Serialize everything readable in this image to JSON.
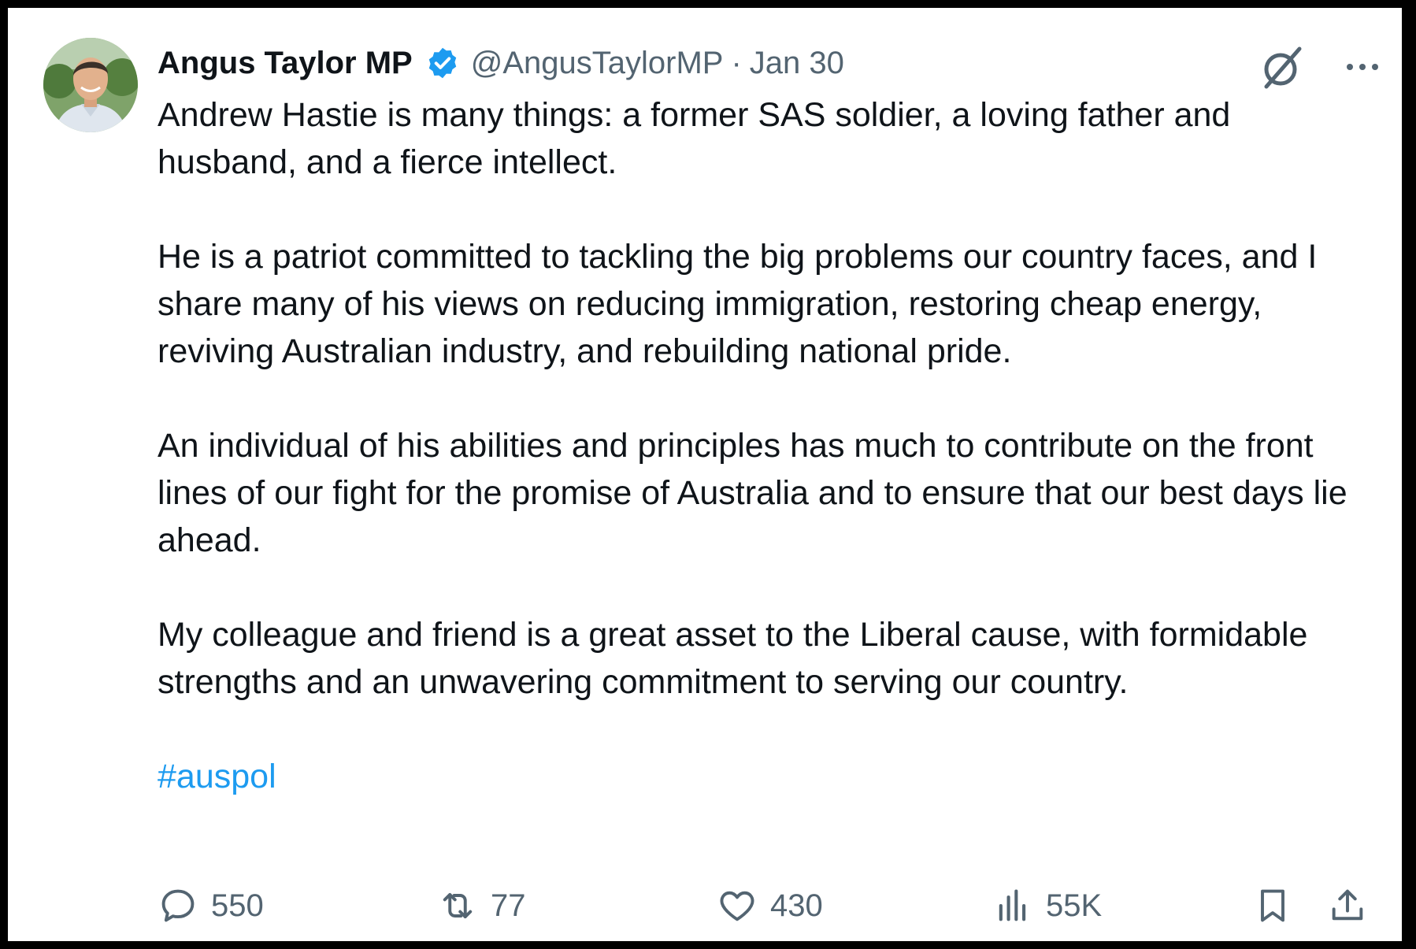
{
  "tweet": {
    "author_name": "Angus Taylor MP",
    "handle": "@AngusTaylorMP",
    "separator": "·",
    "date": "Jan 30",
    "paragraphs": [
      "Andrew Hastie is many things: a former SAS soldier, a loving father and husband, and a fierce intellect.",
      "He is a patriot committed to tackling the big problems our country faces, and I share many of his views on reducing immigration, restoring cheap energy, reviving Australian industry, and rebuilding national pride.",
      "An individual of his abilities and principles has much to contribute on the front lines of our fight for the promise of Australia and to ensure that our best days lie ahead.",
      "My colleague and friend is a great asset to the Liberal cause, with formidable strengths and an unwavering commitment to serving our country."
    ],
    "hashtag": "#auspol"
  },
  "actions": {
    "replies": "550",
    "reposts": "77",
    "likes": "430",
    "views": "55K"
  },
  "icons": {
    "verified": "verified-badge-icon",
    "grok": "grok-icon",
    "more": "more-icon",
    "reply": "reply-icon",
    "repost": "repost-icon",
    "like": "heart-icon",
    "views": "views-icon",
    "bookmark": "bookmark-icon",
    "share": "share-icon"
  },
  "colors": {
    "text": "#0f1419",
    "secondary": "#536471",
    "accent": "#1d9bf0"
  }
}
